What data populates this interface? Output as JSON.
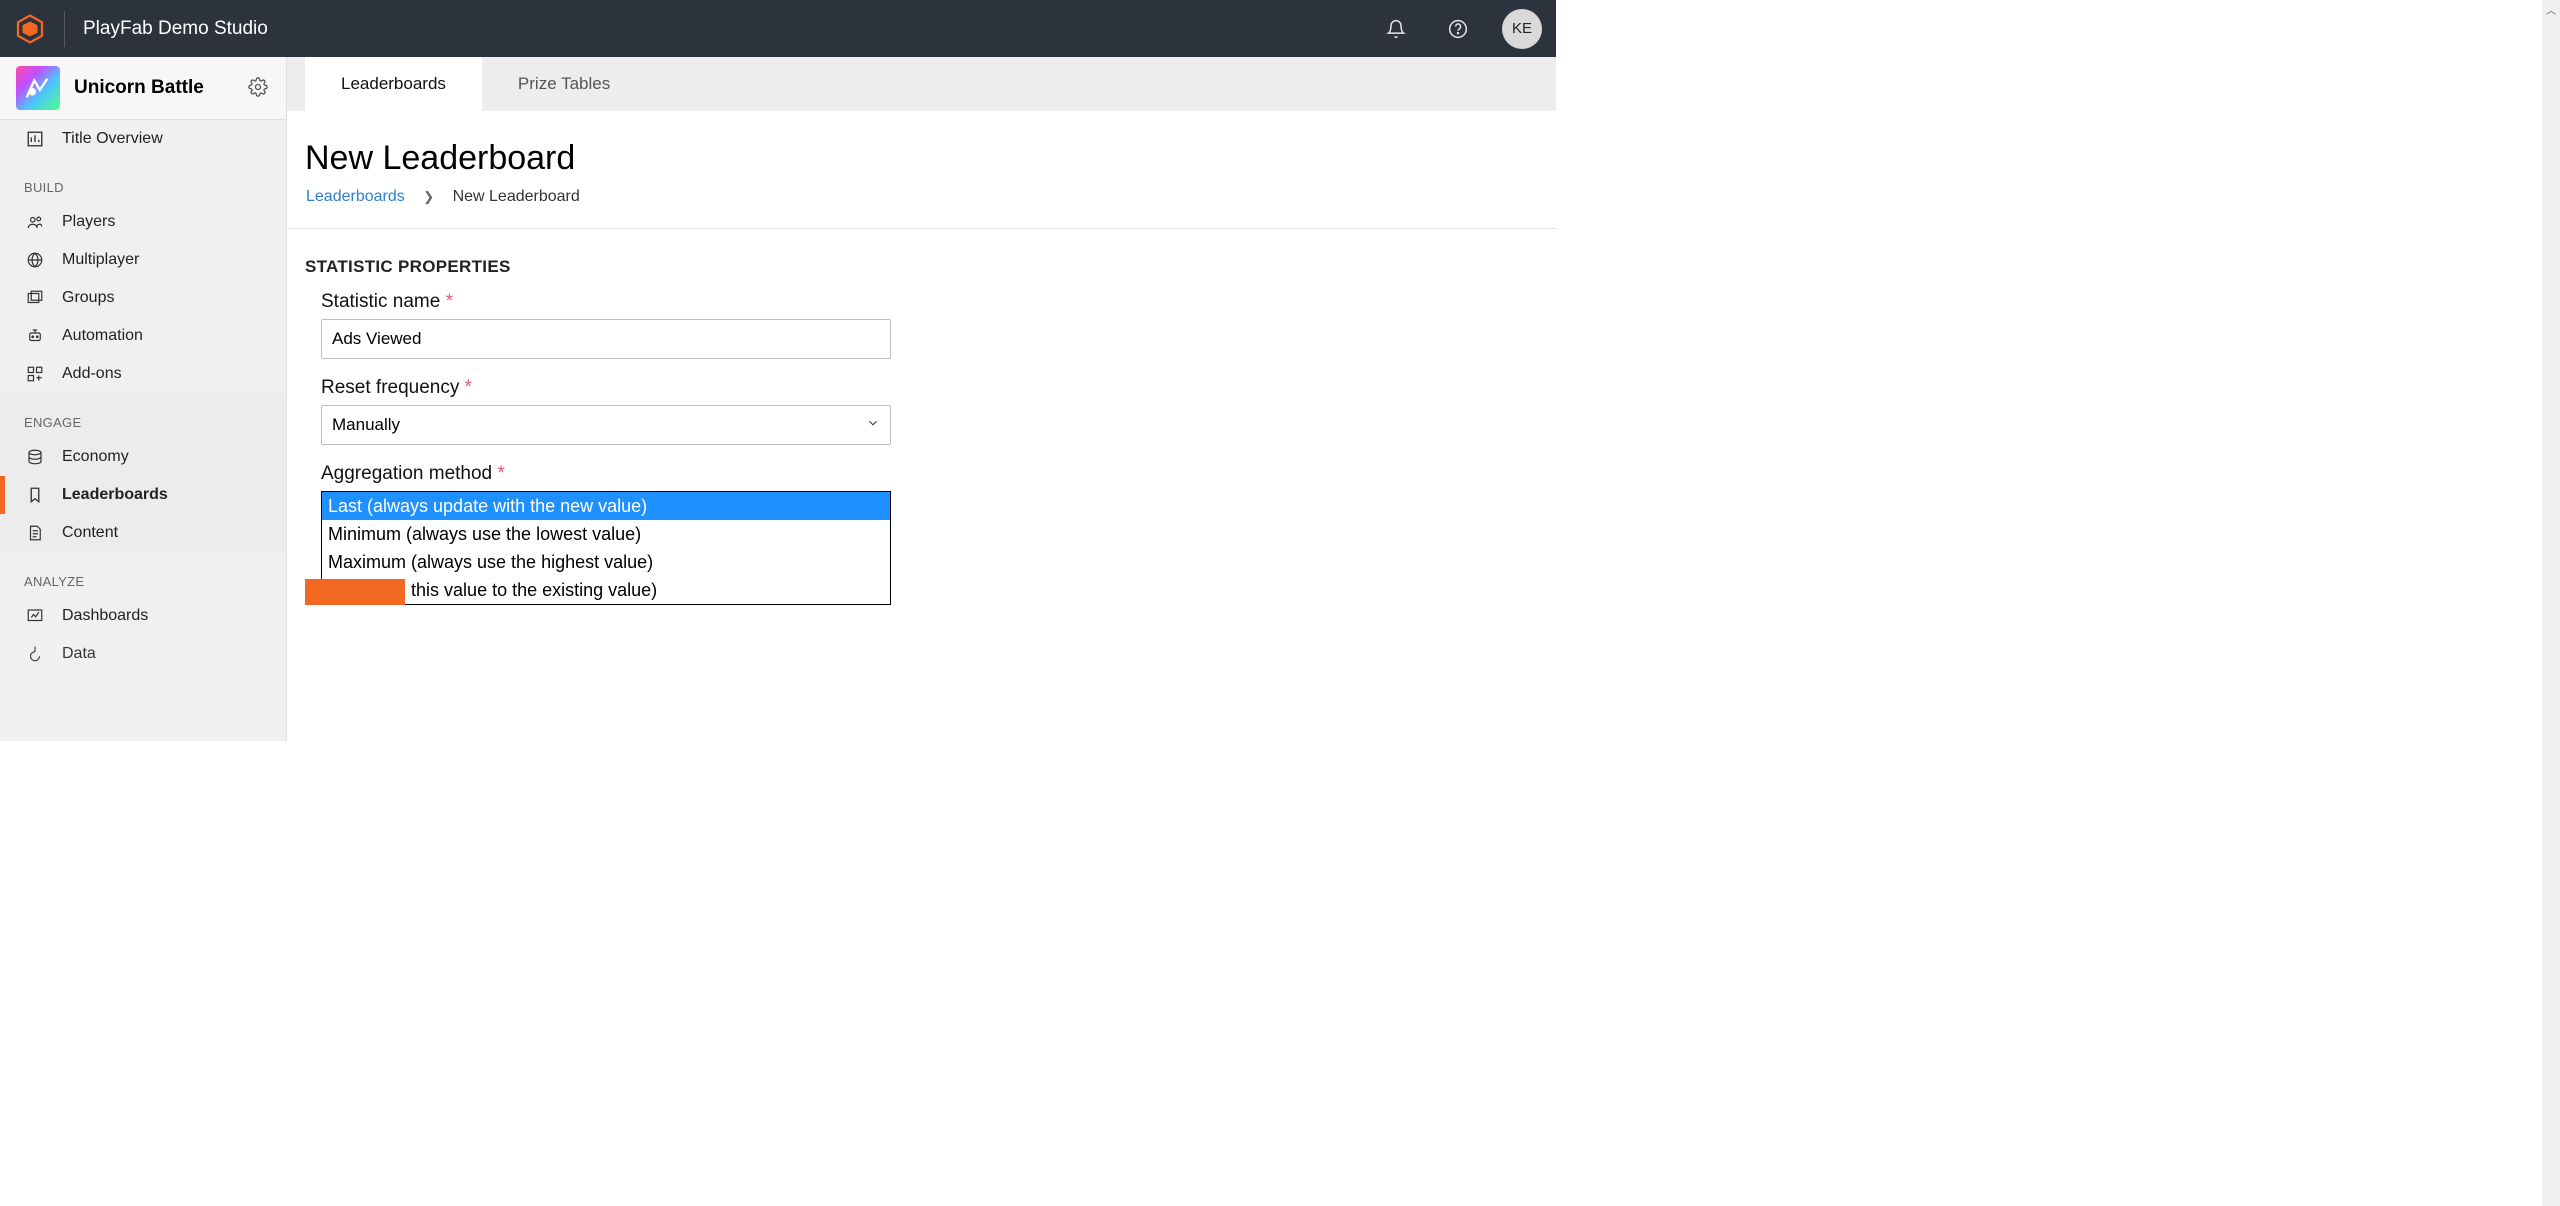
{
  "topbar": {
    "studio_name": "PlayFab Demo Studio",
    "avatar_initials": "KE"
  },
  "game": {
    "title": "Unicorn Battle"
  },
  "sidebar": {
    "title_overview": "Title Overview",
    "sections": {
      "build": "BUILD",
      "engage": "ENGAGE",
      "analyze": "ANALYZE"
    },
    "build_items": {
      "players": "Players",
      "multiplayer": "Multiplayer",
      "groups": "Groups",
      "automation": "Automation",
      "addons": "Add-ons"
    },
    "engage_items": {
      "economy": "Economy",
      "leaderboards": "Leaderboards",
      "content": "Content"
    },
    "analyze_items": {
      "dashboards": "Dashboards",
      "data": "Data"
    }
  },
  "tabs": {
    "leaderboards": "Leaderboards",
    "prize_tables": "Prize Tables"
  },
  "page": {
    "title": "New Leaderboard"
  },
  "breadcrumb": {
    "link": "Leaderboards",
    "current": "New Leaderboard"
  },
  "form": {
    "section_heading": "STATISTIC PROPERTIES",
    "statistic_name_label": "Statistic name",
    "statistic_name_value": "Ads Viewed",
    "reset_frequency_label": "Reset frequency",
    "reset_frequency_value": "Manually",
    "aggregation_label": "Aggregation method",
    "aggregation_options": {
      "last": "Last (always update with the new value)",
      "min": "Minimum (always use the lowest value)",
      "max": "Maximum (always use the highest value)",
      "sum": "Sum (add this value to the existing value)"
    }
  }
}
